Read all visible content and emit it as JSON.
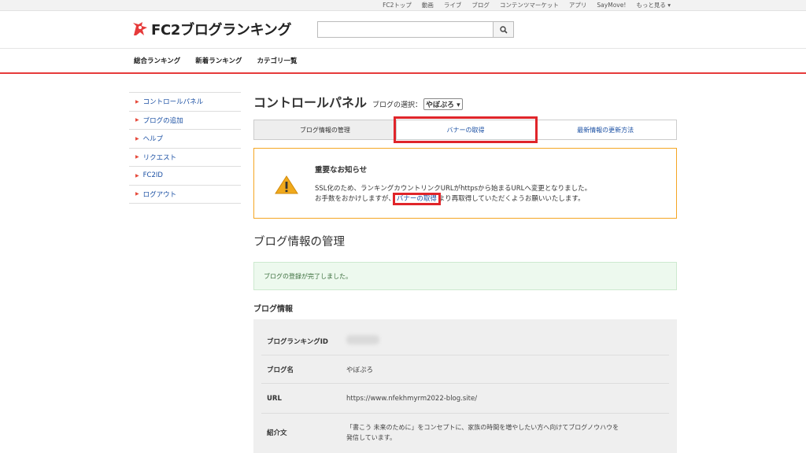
{
  "topnav": {
    "items": [
      "FC2トップ",
      "動画",
      "ライブ",
      "ブログ",
      "コンテンツマーケット",
      "アプリ",
      "SayMove!"
    ],
    "more": "もっと見る ▾"
  },
  "header": {
    "logo_text": "FC2ブログランキング",
    "search_placeholder": ""
  },
  "mainnav": [
    "総合ランキング",
    "新着ランキング",
    "カテゴリ一覧"
  ],
  "sidebar": {
    "items": [
      {
        "label": "コントロールパネル"
      },
      {
        "label": "ブログの追加"
      },
      {
        "label": "ヘルプ"
      },
      {
        "label": "リクエスト"
      },
      {
        "label": "FC2ID"
      },
      {
        "label": "ログアウト"
      }
    ]
  },
  "page": {
    "title": "コントロールパネル",
    "blog_select_label": "ブログの選択：",
    "blog_select_value": "やぼぷろ ▾"
  },
  "tabs": [
    {
      "label": "ブログ情報の管理"
    },
    {
      "label": "バナーの取得"
    },
    {
      "label": "最新情報の更新方法"
    }
  ],
  "notice": {
    "title": "重要なお知らせ",
    "line1": "SSL化のため、ランキングカウントリンクURLがhttpsから始まるURLへ変更となりました。",
    "line2_before": "お手数をおかけしますが、",
    "line2_link": "バナーの取得",
    "line2_after": "より再取得していただくようお願いいたします。"
  },
  "section": {
    "title": "ブログ情報の管理",
    "success_message": "ブログの登録が完了しました。",
    "info_title": "ブログ情報"
  },
  "info_rows": [
    {
      "key": "ブログランキングID",
      "value": ""
    },
    {
      "key": "ブログ名",
      "value": "やぼぷろ"
    },
    {
      "key": "URL",
      "value": "https://www.nfekhmyrm2022-blog.site/"
    },
    {
      "key": "紹介文",
      "value": "「書こう 未来のために」をコンセプトに、家族の時間を増やしたい方へ向けてブログノウハウを",
      "value2": "発信しています。"
    }
  ],
  "colors": {
    "accent_red": "#e63b3b",
    "highlight_red": "#e0252a",
    "link_blue": "#1a4fa3",
    "notice_border": "#f5a623",
    "success_bg": "#edf9ee"
  }
}
